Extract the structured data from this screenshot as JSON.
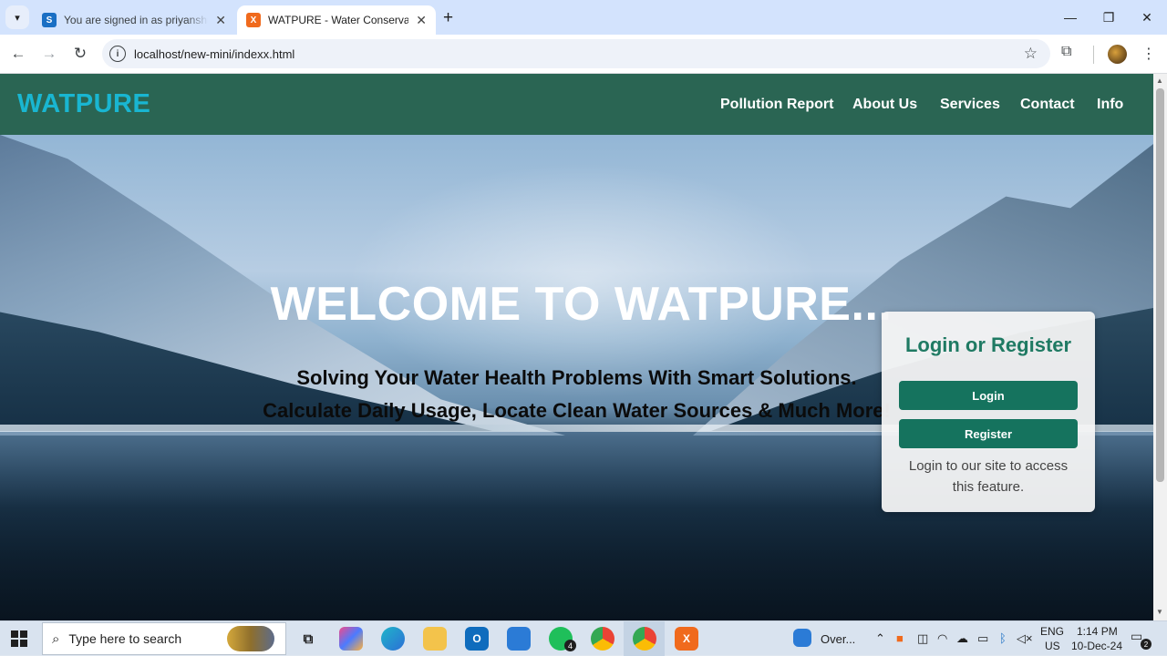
{
  "browser": {
    "tabs": [
      {
        "title": "You are signed in as priyanshu...",
        "favicon": "S",
        "favicon_color": "#1a6fc4",
        "active": false
      },
      {
        "title": "WATPURE - Water Conservation",
        "favicon": "X",
        "favicon_color": "#f06a1d",
        "active": true
      }
    ],
    "tab_close": "✕",
    "new_tab": "+",
    "url": "localhost/new-mini/indexx.html",
    "window_controls": {
      "minimize": "—",
      "restore": "❐",
      "close": "✕"
    }
  },
  "site": {
    "brand": "WATPURE",
    "brand_color": "#19b6d1",
    "navbar_color": "#2a6553",
    "nav_links": [
      "Pollution Report",
      "About Us",
      "Services",
      "Contact",
      "Info"
    ],
    "hero": {
      "title": "WELCOME TO WATPURE...",
      "subtitle_1": "Solving Your Water Health Problems With Smart Solutions.",
      "subtitle_2": "Calculate Daily Usage, Locate Clean Water Sources & Much More!"
    },
    "login_card": {
      "heading": "Login or Register",
      "login_label": "Login",
      "register_label": "Register",
      "note": "Login to our site to access this feature.",
      "accent_color": "#15735e"
    }
  },
  "taskbar": {
    "search_placeholder": "Type here to search",
    "whatsapp_badge": "4",
    "weather_label": "Over...",
    "language": "ENG",
    "region": "US",
    "time": "1:14 PM",
    "date": "10-Dec-24",
    "notification_count": "2"
  }
}
